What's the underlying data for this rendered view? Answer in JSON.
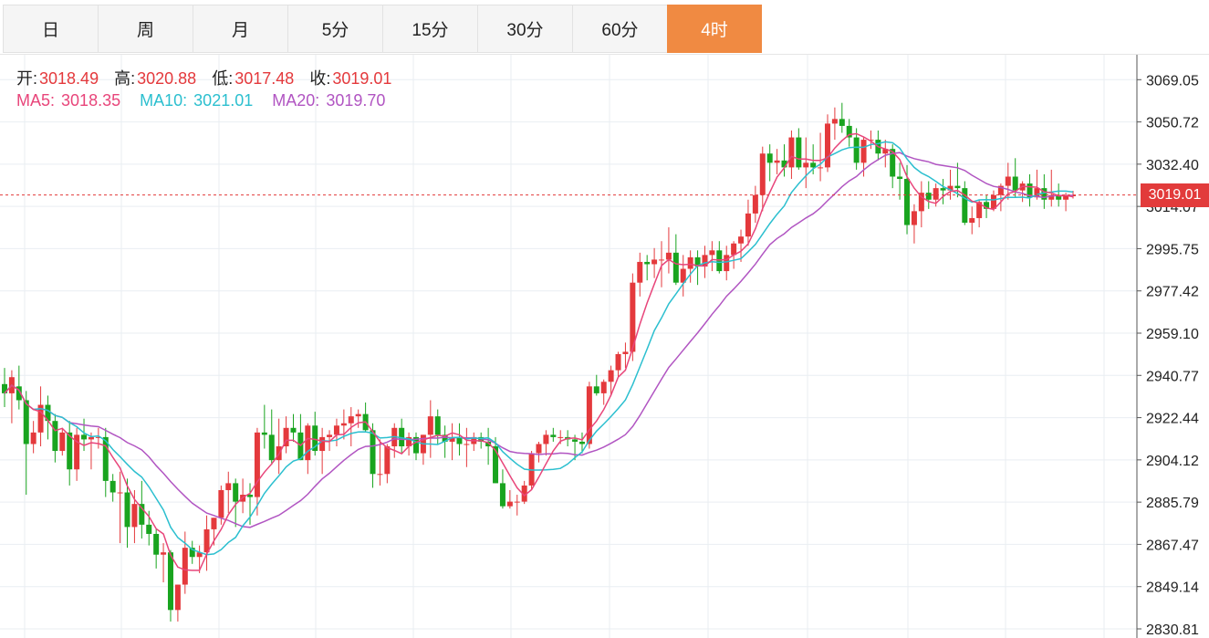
{
  "tabs": [
    "日",
    "周",
    "月",
    "5分",
    "15分",
    "30分",
    "60分",
    "4时"
  ],
  "active_tab": "4时",
  "ohlc": {
    "open_label": "开:",
    "open": "3018.49",
    "high_label": "高:",
    "high": "3020.88",
    "low_label": "低:",
    "low": "3017.48",
    "close_label": "收:",
    "close": "3019.01"
  },
  "ma": {
    "ma5_label": "MA5:",
    "ma5": "3018.35",
    "ma10_label": "MA10:",
    "ma10": "3021.01",
    "ma20_label": "MA20:",
    "ma20": "3019.70"
  },
  "current_price": "3019.01",
  "colors": {
    "up": "#e4393c",
    "down": "#19a41f",
    "ma5": "#e8457a",
    "ma10": "#2bbfcf",
    "ma20": "#b155c2",
    "accent": "#f08a42"
  },
  "chart_data": {
    "type": "candlestick",
    "y_ticks": [
      "3069.05",
      "3050.72",
      "3032.40",
      "3014.07",
      "2995.75",
      "2977.42",
      "2959.10",
      "2940.77",
      "2922.44",
      "2904.12",
      "2885.79",
      "2867.47",
      "2849.14",
      "2830.81"
    ],
    "ylim": [
      2830.81,
      3087.38
    ],
    "current": 3019.01,
    "candles": [
      [
        2937.0,
        2944.0,
        2927.0,
        2933.0
      ],
      [
        2933.0,
        2943.0,
        2920.0,
        2940.0
      ],
      [
        2936.0,
        2945.0,
        2926.0,
        2930.0
      ],
      [
        2930.0,
        2934.0,
        2889.0,
        2911.0
      ],
      [
        2911.0,
        2921.0,
        2907.0,
        2916.0
      ],
      [
        2916.0,
        2936.0,
        2910.0,
        2928.0
      ],
      [
        2928.0,
        2932.0,
        2913.0,
        2921.0
      ],
      [
        2921.0,
        2924.0,
        2903.0,
        2908.0
      ],
      [
        2908.0,
        2918.0,
        2906.0,
        2916.0
      ],
      [
        2916.0,
        2921.0,
        2893.0,
        2900.0
      ],
      [
        2900.0,
        2918.0,
        2895.0,
        2915.0
      ],
      [
        2915.0,
        2922.0,
        2908.0,
        2913.0
      ],
      [
        2913.0,
        2916.0,
        2900.0,
        2914.0
      ],
      [
        2914.0,
        2918.0,
        2909.0,
        2914.0
      ],
      [
        2914.0,
        2918.0,
        2888.0,
        2895.0
      ],
      [
        2895.0,
        2898.0,
        2886.0,
        2890.0
      ],
      [
        2890.0,
        2899.0,
        2868.0,
        2890.0
      ],
      [
        2890.0,
        2896.0,
        2866.0,
        2875.0
      ],
      [
        2875.0,
        2891.0,
        2868.0,
        2885.0
      ],
      [
        2885.0,
        2895.0,
        2870.0,
        2876.0
      ],
      [
        2876.0,
        2882.0,
        2867.0,
        2872.0
      ],
      [
        2872.0,
        2874.0,
        2857.0,
        2863.0
      ],
      [
        2863.0,
        2868.0,
        2851.0,
        2864.0
      ],
      [
        2864.0,
        2865.0,
        2834.0,
        2839.0
      ],
      [
        2839.0,
        2850.0,
        2834.0,
        2850.0
      ],
      [
        2850.0,
        2873.0,
        2846.0,
        2866.0
      ],
      [
        2866.0,
        2869.0,
        2859.0,
        2862.0
      ],
      [
        2862.0,
        2867.0,
        2855.0,
        2864.0
      ],
      [
        2864.0,
        2880.0,
        2856.0,
        2874.0
      ],
      [
        2874.0,
        2879.0,
        2867.0,
        2879.0
      ],
      [
        2879.0,
        2893.0,
        2876.0,
        2891.0
      ],
      [
        2891.0,
        2899.0,
        2881.0,
        2894.0
      ],
      [
        2894.0,
        2896.0,
        2875.0,
        2886.0
      ],
      [
        2886.0,
        2896.0,
        2881.0,
        2889.0
      ],
      [
        2889.0,
        2894.0,
        2876.0,
        2888.0
      ],
      [
        2888.0,
        2918.0,
        2880.0,
        2916.0
      ],
      [
        2916.0,
        2928.0,
        2909.0,
        2915.0
      ],
      [
        2915.0,
        2926.0,
        2902.0,
        2904.0
      ],
      [
        2904.0,
        2922.0,
        2898.0,
        2910.0
      ],
      [
        2910.0,
        2923.0,
        2907.0,
        2918.0
      ],
      [
        2918.0,
        2924.0,
        2912.0,
        2916.0
      ],
      [
        2916.0,
        2924.0,
        2904.0,
        2904.0
      ],
      [
        2904.0,
        2920.0,
        2898.0,
        2919.0
      ],
      [
        2919.0,
        2925.0,
        2906.0,
        2908.0
      ],
      [
        2908.0,
        2918.0,
        2898.0,
        2914.0
      ],
      [
        2914.0,
        2917.0,
        2908.0,
        2915.0
      ],
      [
        2915.0,
        2922.0,
        2910.0,
        2919.0
      ],
      [
        2919.0,
        2926.0,
        2913.0,
        2920.0
      ],
      [
        2920.0,
        2927.0,
        2910.0,
        2923.0
      ],
      [
        2923.0,
        2926.0,
        2918.0,
        2924.0
      ],
      [
        2924.0,
        2929.0,
        2916.0,
        2917.0
      ],
      [
        2917.0,
        2920.0,
        2892.0,
        2898.0
      ],
      [
        2898.0,
        2913.0,
        2893.0,
        2898.0
      ],
      [
        2898.0,
        2911.0,
        2894.0,
        2910.0
      ],
      [
        2910.0,
        2920.0,
        2905.0,
        2918.0
      ],
      [
        2918.0,
        2922.0,
        2907.0,
        2910.0
      ],
      [
        2910.0,
        2916.0,
        2906.0,
        2914.0
      ],
      [
        2914.0,
        2916.0,
        2904.0,
        2907.0
      ],
      [
        2907.0,
        2915.0,
        2902.0,
        2915.0
      ],
      [
        2915.0,
        2930.0,
        2905.0,
        2923.0
      ],
      [
        2923.0,
        2926.0,
        2911.0,
        2915.0
      ],
      [
        2915.0,
        2919.0,
        2905.0,
        2912.0
      ],
      [
        2912.0,
        2920.0,
        2904.0,
        2914.0
      ],
      [
        2914.0,
        2920.0,
        2906.0,
        2911.0
      ],
      [
        2911.0,
        2918.0,
        2901.0,
        2911.0
      ],
      [
        2911.0,
        2916.0,
        2908.0,
        2914.0
      ],
      [
        2914.0,
        2916.0,
        2909.0,
        2912.0
      ],
      [
        2912.0,
        2918.0,
        2902.0,
        2910.0
      ],
      [
        2910.0,
        2914.0,
        2894.0,
        2894.0
      ],
      [
        2894.0,
        2900.0,
        2883.0,
        2884.0
      ],
      [
        2884.0,
        2891.0,
        2883.0,
        2886.0
      ],
      [
        2886.0,
        2889.0,
        2880.0,
        2886.0
      ],
      [
        2886.0,
        2895.0,
        2885.0,
        2893.0
      ],
      [
        2893.0,
        2908.0,
        2891.0,
        2907.0
      ],
      [
        2907.0,
        2912.0,
        2903.0,
        2911.0
      ],
      [
        2911.0,
        2917.0,
        2906.0,
        2915.0
      ],
      [
        2915.0,
        2918.0,
        2912.0,
        2914.0
      ],
      [
        2914.0,
        2917.0,
        2911.0,
        2914.0
      ],
      [
        2914.0,
        2917.0,
        2910.0,
        2913.0
      ],
      [
        2913.0,
        2915.0,
        2904.0,
        2912.0
      ],
      [
        2912.0,
        2916.0,
        2907.0,
        2911.0
      ],
      [
        2911.0,
        2938.0,
        2909.0,
        2936.0
      ],
      [
        2936.0,
        2941.0,
        2932.0,
        2933.0
      ],
      [
        2933.0,
        2939.0,
        2928.0,
        2938.0
      ],
      [
        2938.0,
        2945.0,
        2932.0,
        2943.0
      ],
      [
        2943.0,
        2951.0,
        2940.0,
        2950.0
      ],
      [
        2950.0,
        2955.0,
        2944.0,
        2951.0
      ],
      [
        2951.0,
        2985.0,
        2947.0,
        2981.0
      ],
      [
        2981.0,
        2994.0,
        2975.0,
        2990.0
      ],
      [
        2990.0,
        2993.0,
        2982.0,
        2989.0
      ],
      [
        2989.0,
        2996.0,
        2983.0,
        2991.0
      ],
      [
        2991.0,
        2999.0,
        2979.0,
        2991.0
      ],
      [
        2991.0,
        3005.0,
        2985.0,
        2994.0
      ],
      [
        2994.0,
        3002.0,
        2980.0,
        2981.0
      ],
      [
        2981.0,
        2993.0,
        2975.0,
        2987.0
      ],
      [
        2987.0,
        2995.0,
        2981.0,
        2992.0
      ],
      [
        2992.0,
        2995.0,
        2980.0,
        2988.0
      ],
      [
        2988.0,
        2997.0,
        2983.0,
        2993.0
      ],
      [
        2993.0,
        2999.0,
        2986.0,
        2995.0
      ],
      [
        2995.0,
        2999.0,
        2985.0,
        2986.0
      ],
      [
        2986.0,
        2997.0,
        2982.0,
        2993.0
      ],
      [
        2993.0,
        2999.0,
        2987.0,
        2998.0
      ],
      [
        2998.0,
        3004.0,
        2990.0,
        3001.0
      ],
      [
        3001.0,
        3017.0,
        2997.0,
        3011.0
      ],
      [
        3011.0,
        3023.0,
        3007.0,
        3019.0
      ],
      [
        3019.0,
        3040.0,
        3012.0,
        3037.0
      ],
      [
        3037.0,
        3041.0,
        3025.0,
        3033.0
      ],
      [
        3033.0,
        3039.0,
        3028.0,
        3034.0
      ],
      [
        3034.0,
        3041.0,
        3027.0,
        3031.0
      ],
      [
        3031.0,
        3047.0,
        3026.0,
        3044.0
      ],
      [
        3044.0,
        3048.0,
        3030.0,
        3031.0
      ],
      [
        3031.0,
        3044.0,
        3022.0,
        3033.0
      ],
      [
        3033.0,
        3041.0,
        3028.0,
        3031.0
      ],
      [
        3031.0,
        3046.0,
        3025.0,
        3031.0
      ],
      [
        3031.0,
        3054.0,
        3029.0,
        3050.0
      ],
      [
        3050.0,
        3057.0,
        3043.0,
        3052.0
      ],
      [
        3052.0,
        3059.0,
        3046.0,
        3049.0
      ],
      [
        3049.0,
        3052.0,
        3040.0,
        3044.0
      ],
      [
        3044.0,
        3048.0,
        3030.0,
        3033.0
      ],
      [
        3033.0,
        3044.0,
        3027.0,
        3043.0
      ],
      [
        3043.0,
        3047.0,
        3039.0,
        3043.0
      ],
      [
        3043.0,
        3047.0,
        3034.0,
        3037.0
      ],
      [
        3037.0,
        3043.0,
        3031.0,
        3039.0
      ],
      [
        3039.0,
        3041.0,
        3022.0,
        3027.0
      ],
      [
        3027.0,
        3033.0,
        3017.0,
        3026.0
      ],
      [
        3026.0,
        3032.0,
        3002.0,
        3006.0
      ],
      [
        3006.0,
        3015.0,
        2998.0,
        3012.0
      ],
      [
        3012.0,
        3025.0,
        3005.0,
        3020.0
      ],
      [
        3020.0,
        3025.0,
        3013.0,
        3017.0
      ],
      [
        3017.0,
        3024.0,
        3014.0,
        3022.0
      ],
      [
        3022.0,
        3026.0,
        3015.0,
        3021.0
      ],
      [
        3021.0,
        3030.0,
        3017.0,
        3023.0
      ],
      [
        3023.0,
        3033.0,
        3018.0,
        3022.0
      ],
      [
        3022.0,
        3025.0,
        3006.0,
        3007.0
      ],
      [
        3007.0,
        3014.0,
        3002.0,
        3009.0
      ],
      [
        3009.0,
        3017.0,
        3005.0,
        3016.0
      ],
      [
        3016.0,
        3019.0,
        3009.0,
        3013.0
      ],
      [
        3013.0,
        3021.0,
        3012.0,
        3019.0
      ],
      [
        3019.0,
        3024.0,
        3012.0,
        3023.0
      ],
      [
        3023.0,
        3033.0,
        3017.0,
        3027.0
      ],
      [
        3027.0,
        3035.0,
        3018.0,
        3021.0
      ],
      [
        3021.0,
        3025.0,
        3016.0,
        3024.0
      ],
      [
        3024.0,
        3028.0,
        3014.0,
        3018.0
      ],
      [
        3018.0,
        3030.0,
        3017.0,
        3022.0
      ],
      [
        3022.0,
        3028.0,
        3013.0,
        3017.0
      ],
      [
        3017.0,
        3030.0,
        3014.0,
        3019.0
      ],
      [
        3019.0,
        3024.0,
        3014.0,
        3017.0
      ],
      [
        3017.0,
        3020.0,
        3012.0,
        3019.0
      ],
      [
        3018.49,
        3020.88,
        3017.48,
        3019.01
      ]
    ]
  }
}
